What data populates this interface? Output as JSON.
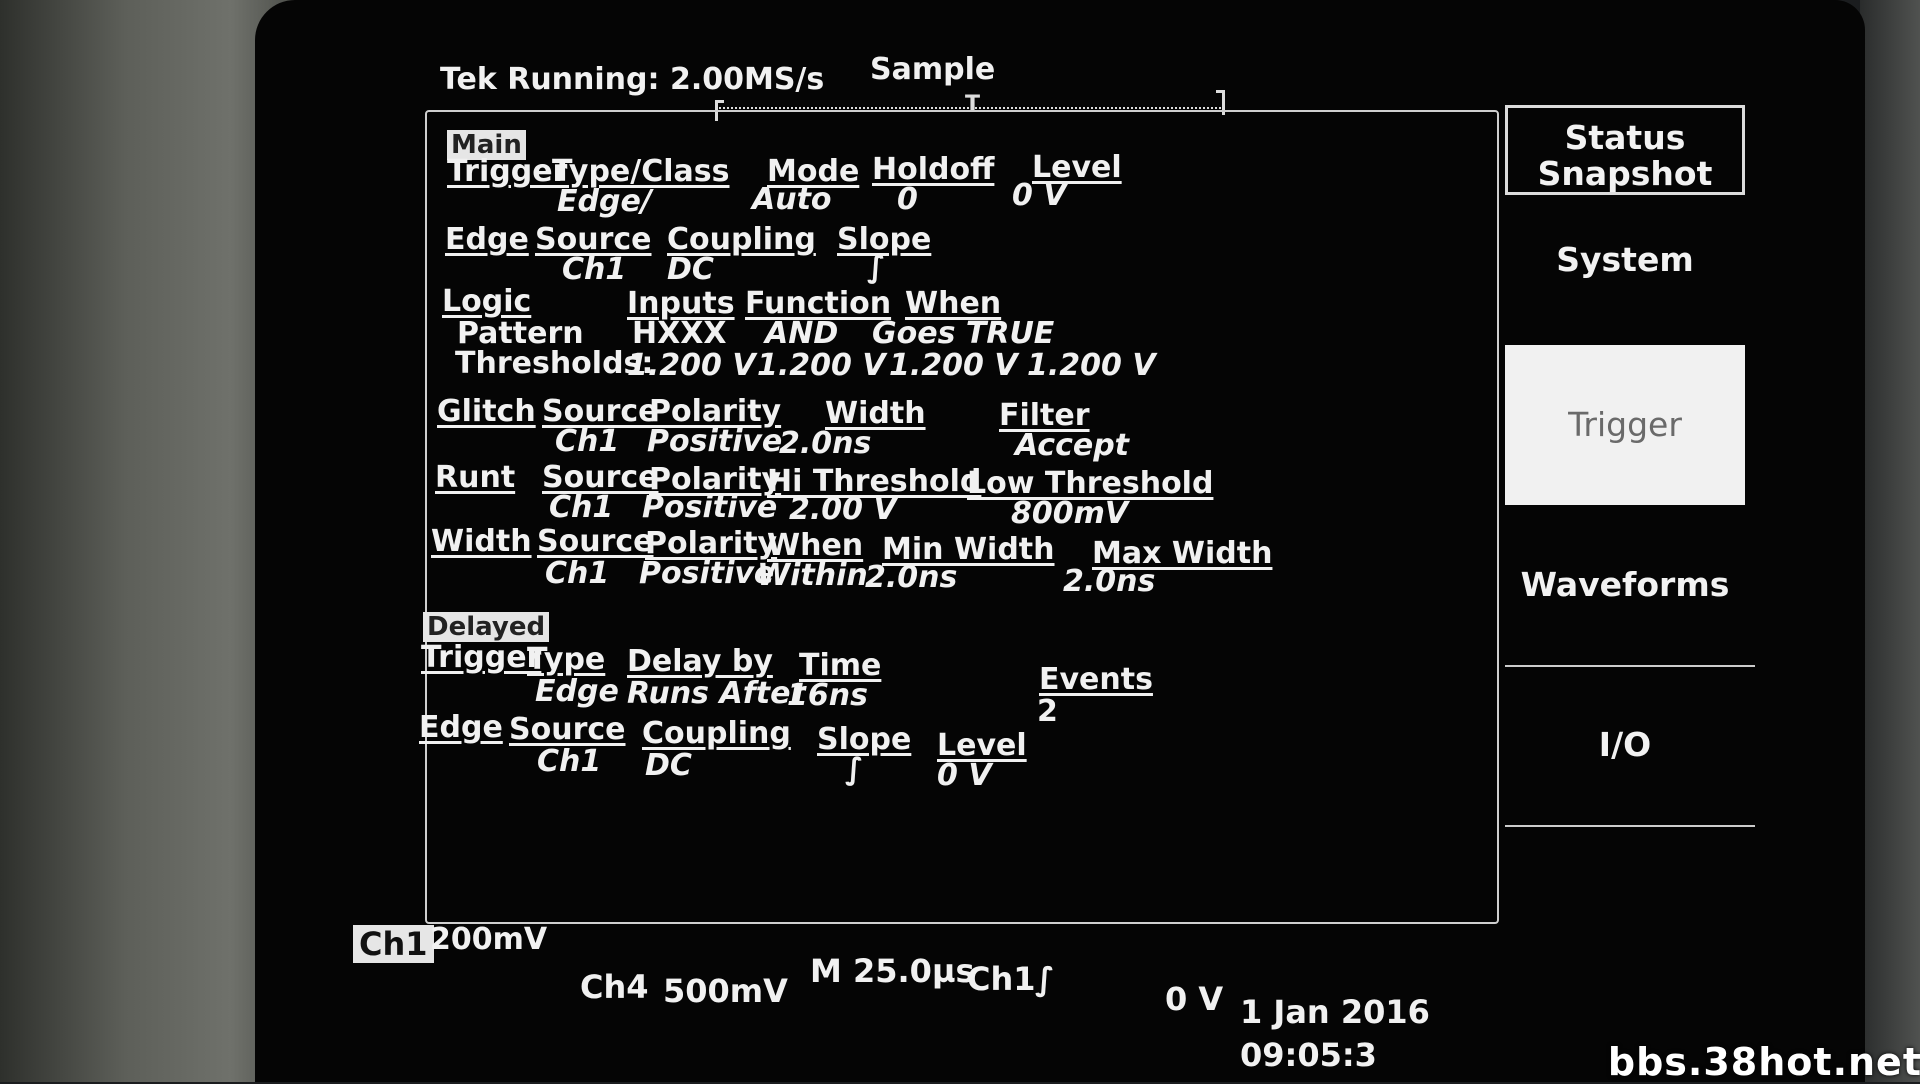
{
  "header": {
    "title": "Tek Running: 2.00MS/s",
    "mode": "Sample"
  },
  "main": {
    "label": "Main",
    "trigger_headers": [
      "Trigger",
      "Type/Class",
      "Mode",
      "Holdoff",
      "Level"
    ],
    "trigger_values": [
      "Edge/",
      "Auto",
      "0",
      "0 V"
    ],
    "edge_headers": [
      "Edge",
      "Source",
      "Coupling",
      "Slope"
    ],
    "edge_values": [
      "Ch1",
      "DC",
      "∫"
    ],
    "logic_headers": [
      "Logic",
      "Inputs",
      "Function",
      "When"
    ],
    "logic_pattern": [
      "Pattern",
      "HXXX",
      "AND",
      "Goes TRUE"
    ],
    "logic_thresholds": [
      "Thresholds:",
      "1.200 V",
      "1.200 V",
      "1.200 V",
      "1.200 V"
    ],
    "glitch_headers": [
      "Glitch",
      "Source",
      "Polarity",
      "Width",
      "Filter"
    ],
    "glitch_values": [
      "Ch1",
      "Positive",
      "2.0ns",
      "Accept"
    ],
    "runt_headers": [
      "Runt",
      "Source",
      "Polarity",
      "Hi Threshold",
      "Low Threshold"
    ],
    "runt_values": [
      "Ch1",
      "Positive",
      "2.00 V",
      "800mV"
    ],
    "width_headers": [
      "Width",
      "Source",
      "Polarity",
      "When",
      "Min Width",
      "Max Width"
    ],
    "width_values": [
      "Ch1",
      "Positive",
      "Within",
      "2.0ns",
      "2.0ns"
    ]
  },
  "delayed": {
    "label": "Delayed",
    "trigger_headers": [
      "Trigger",
      "Type",
      "Delay by",
      "Time",
      "Events"
    ],
    "trigger_values": [
      "Edge",
      "Runs After",
      "16ns",
      "2"
    ],
    "edge_headers": [
      "Edge",
      "Source",
      "Coupling",
      "Slope",
      "Level"
    ],
    "edge_values": [
      "Ch1",
      "DC",
      "∫",
      "0 V"
    ]
  },
  "menu": {
    "status_snapshot": "Status Snapshot",
    "system": "System",
    "trigger": "Trigger",
    "waveforms": "Waveforms",
    "io": "I/O"
  },
  "readout": {
    "ch1_label": "Ch1",
    "ch1_scale": "200mV",
    "ch4": "Ch4",
    "ch4_scale": "500mV",
    "timebase": "M 25.0µs",
    "trigger_source": "Ch1",
    "trigger_slope": "∫",
    "trigger_level": "0 V",
    "date": "1 Jan 2016",
    "time": "09:05:3"
  },
  "watermark": "bbs.38hot.net"
}
